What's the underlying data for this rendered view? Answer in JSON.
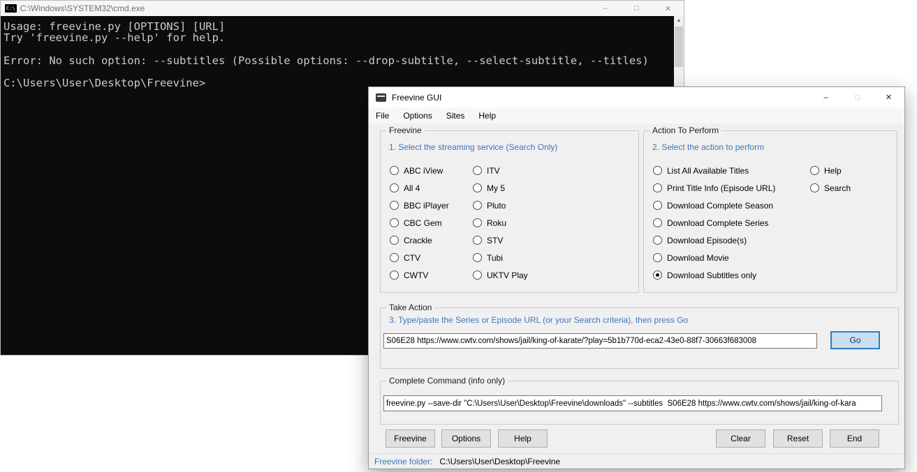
{
  "icons": {
    "minimize": "–",
    "maximize": "□",
    "close": "✕",
    "scroll_up": "▲",
    "scroll_down": "▼",
    "cmd_badge": "C:\\"
  },
  "cmd_window": {
    "title": "C:\\Windows\\SYSTEM32\\cmd.exe",
    "console_lines": [
      "Usage: freevine.py [OPTIONS] [URL]",
      "Try 'freevine.py --help' for help.",
      "",
      "Error: No such option: --subtitles (Possible options: --drop-subtitle, --select-subtitle, --titles)",
      "",
      "C:\\Users\\User\\Desktop\\Freevine>"
    ]
  },
  "gui_window": {
    "title": "Freevine GUI",
    "menu_items": [
      "File",
      "Options",
      "Sites",
      "Help"
    ],
    "service_group": {
      "label": "Freevine",
      "instruction": "1. Select the streaming service (Search Only)",
      "col1": [
        "ABC iView",
        "All 4",
        "BBC iPlayer",
        "CBC Gem",
        "Crackle",
        "CTV",
        "CWTV"
      ],
      "col2": [
        "ITV",
        "My 5",
        "Pluto",
        "Roku",
        "STV",
        "Tubi",
        "UKTV Play"
      ]
    },
    "action_group": {
      "label": "Action To Perform",
      "instruction": "2. Select the action to perform",
      "col1": [
        "List All Available Titles",
        "Print Title Info (Episode URL)",
        "Download Complete Season",
        "Download Complete Series",
        "Download Episode(s)",
        "Download Movie",
        "Download Subtitles only"
      ],
      "col2": [
        "Help",
        "Search"
      ],
      "selected": "Download Subtitles only"
    },
    "take_action_group": {
      "label": "Take Action",
      "instruction": "3. Type/paste the Series or Episode URL (or your Search criteria), then press Go",
      "url_value": "S06E28 https://www.cwtv.com/shows/jail/king-of-karate/?play=5b1b770d-eca2-43e0-88f7-30663f683008",
      "go_label": "Go"
    },
    "command_group": {
      "label": "Complete Command (info only)",
      "command_value": "freevine.py --save-dir \"C:\\Users\\User\\Desktop\\Freevine\\downloads\" --subtitles  S06E28 https://www.cwtv.com/shows/jail/king-of-kara"
    },
    "buttons": {
      "freevine": "Freevine",
      "options": "Options",
      "help": "Help",
      "clear": "Clear",
      "reset": "Reset",
      "end": "End"
    },
    "status_bar": {
      "label": "Freevine folder:",
      "value": "C:\\Users\\User\\Desktop\\Freevine"
    }
  }
}
